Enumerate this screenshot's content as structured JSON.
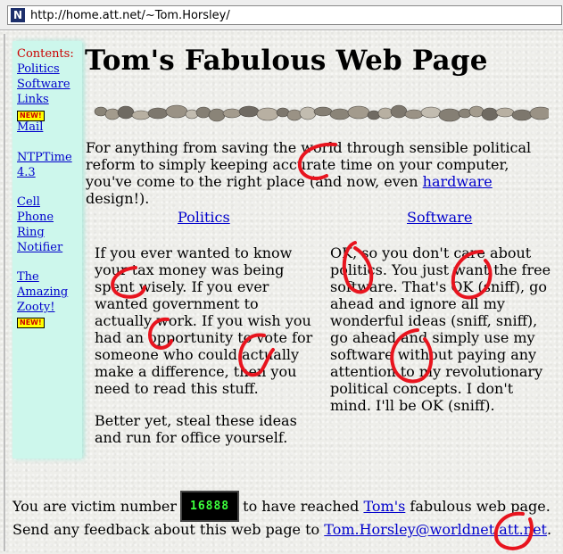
{
  "browser": {
    "url": "http://home.att.net/~Tom.Horsley/",
    "icon_letter": "N"
  },
  "sidebar": {
    "title": "Contents:",
    "items": [
      {
        "label": "Politics"
      },
      {
        "label": "Software"
      },
      {
        "label": "Links",
        "badge": "NEW!"
      },
      {
        "label": "Mail"
      },
      {
        "label_1": "NTPTime",
        "label_2": "4.3"
      },
      {
        "label_1": "Cell",
        "label_2": "Phone",
        "label_3": "Ring",
        "label_4": "Notifier"
      },
      {
        "label_1": "The",
        "label_2": "Amazing",
        "label_3": "Zooty!",
        "badge": "NEW!"
      }
    ]
  },
  "page": {
    "title": "Tom's Fabulous Web Page",
    "intro_before": "For anything from saving the world through sensible political reform to simply keeping accurate time on your computer, you've come to the right place (and now, even ",
    "intro_link": "hardware",
    "intro_after": " design!).",
    "politics": {
      "heading": "Politics",
      "p1": "If you ever wanted to know your tax money was being spent wisely. If you ever wanted government to actually work. If you wish you had an opportunity to vote for someone who could actually make a difference, then you need to read this stuff.",
      "p2": "Better yet, steal these ideas and run for office yourself."
    },
    "software": {
      "heading": "Software",
      "p1": "OK, so you don't care about politics. You just want the free software. That's OK (sniff), go ahead and ignore all my wonderful ideas (sniff, sniff), go ahead and simply use my software without paying any attention to my revolutionary political concepts. I don't mind. I'll be OK (sniff)."
    },
    "counter_before": "You are victim number",
    "counter_value": "16888",
    "counter_after_1": "to have reached",
    "counter_link": "Tom's",
    "counter_after_2": "fabulous web page.",
    "feedback_before": "Send any feedback about this web page to",
    "feedback_email": "Tom.Horsley@worldnet.att.net",
    "feedback_after": "."
  },
  "colors": {
    "sidebar_bg": "#cdf7ec",
    "link": "#0000cc",
    "annotation": "#e8141e",
    "counter_digits": "#3cff3c"
  }
}
